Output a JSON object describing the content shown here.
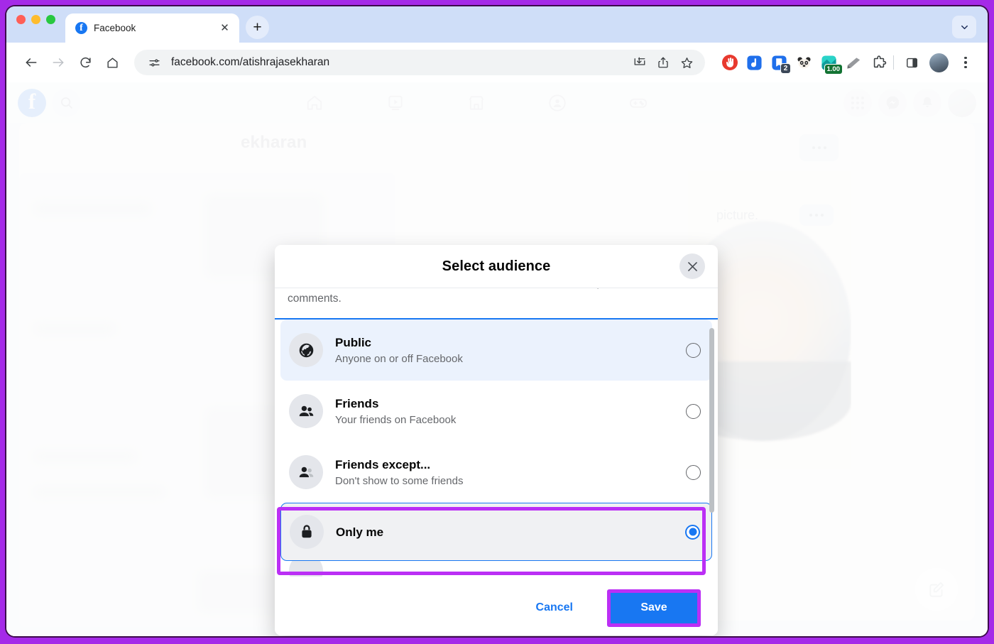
{
  "browser": {
    "tab": {
      "title": "Facebook",
      "favicon": "facebook-icon",
      "close": "✕"
    },
    "new_tab_label": "+",
    "tab_list_chevron": "chevron-down-icon",
    "nav": {
      "back": "back-arrow-icon",
      "forward": "forward-arrow-icon",
      "reload": "reload-icon",
      "home": "home-icon"
    },
    "omnibox": {
      "url": "facebook.com/atishrajasekharan",
      "site_info_icon": "tune-icon",
      "install_icon": "install-app-icon",
      "share_icon": "share-icon",
      "bookmark_icon": "star-icon"
    },
    "extensions": [
      {
        "name": "ublock-origin-icon",
        "badge": ""
      },
      {
        "name": "blue-d-extension-icon",
        "badge": ""
      },
      {
        "name": "notebook-extension-icon",
        "badge": "2"
      },
      {
        "name": "panda-extension-icon",
        "badge": ""
      },
      {
        "name": "currency-extension-icon",
        "badge": "1.00"
      },
      {
        "name": "grammar-extension-icon",
        "badge": ""
      },
      {
        "name": "puzzle-extensions-icon",
        "badge": ""
      }
    ],
    "side_panel_icon": "side-panel-icon",
    "profile_icon": "chrome-profile-avatar",
    "menu_icon": "three-dot-menu-icon"
  },
  "facebook_nav": {
    "logo": "facebook-logo",
    "search": "search-icon",
    "center": [
      {
        "name": "home-icon"
      },
      {
        "name": "video-icon"
      },
      {
        "name": "marketplace-icon"
      },
      {
        "name": "groups-icon"
      },
      {
        "name": "gaming-icon"
      }
    ],
    "right": [
      {
        "name": "menu-grid-icon"
      },
      {
        "name": "messenger-icon"
      },
      {
        "name": "notifications-bell-icon"
      },
      {
        "name": "account-avatar"
      }
    ]
  },
  "background": {
    "profile_name_fragment": "ekharan",
    "post_text_fragment": "picture.",
    "more_icon": "three-dot-icon",
    "edit_icon": "edit-pencil-icon"
  },
  "modal": {
    "title": "Select audience",
    "close_icon": "close-icon",
    "description": "You can decide who should see the other details, like the description, likes or comments.",
    "options": [
      {
        "id": "public",
        "icon": "globe-icon",
        "title": "Public",
        "subtitle": "Anyone on or off Facebook",
        "selected": false,
        "highlighted": true
      },
      {
        "id": "friends",
        "icon": "friends-icon",
        "title": "Friends",
        "subtitle": "Your friends on Facebook",
        "selected": false,
        "highlighted": false
      },
      {
        "id": "friends-except",
        "icon": "friends-except-icon",
        "title": "Friends except...",
        "subtitle": "Don't show to some friends",
        "selected": false,
        "highlighted": false
      },
      {
        "id": "only-me",
        "icon": "lock-icon",
        "title": "Only me",
        "subtitle": "",
        "selected": true,
        "highlighted": false
      }
    ],
    "footer": {
      "cancel_label": "Cancel",
      "save_label": "Save"
    }
  },
  "annotations": {
    "highlight_color": "#bb2ff5",
    "targets": [
      "only-me-row",
      "save-button"
    ]
  },
  "colors": {
    "facebook_blue": "#1877f2",
    "annotation_purple": "#bb2ff5",
    "page_bg": "#f0f2f5",
    "selected_row": "#ebf2fd"
  }
}
